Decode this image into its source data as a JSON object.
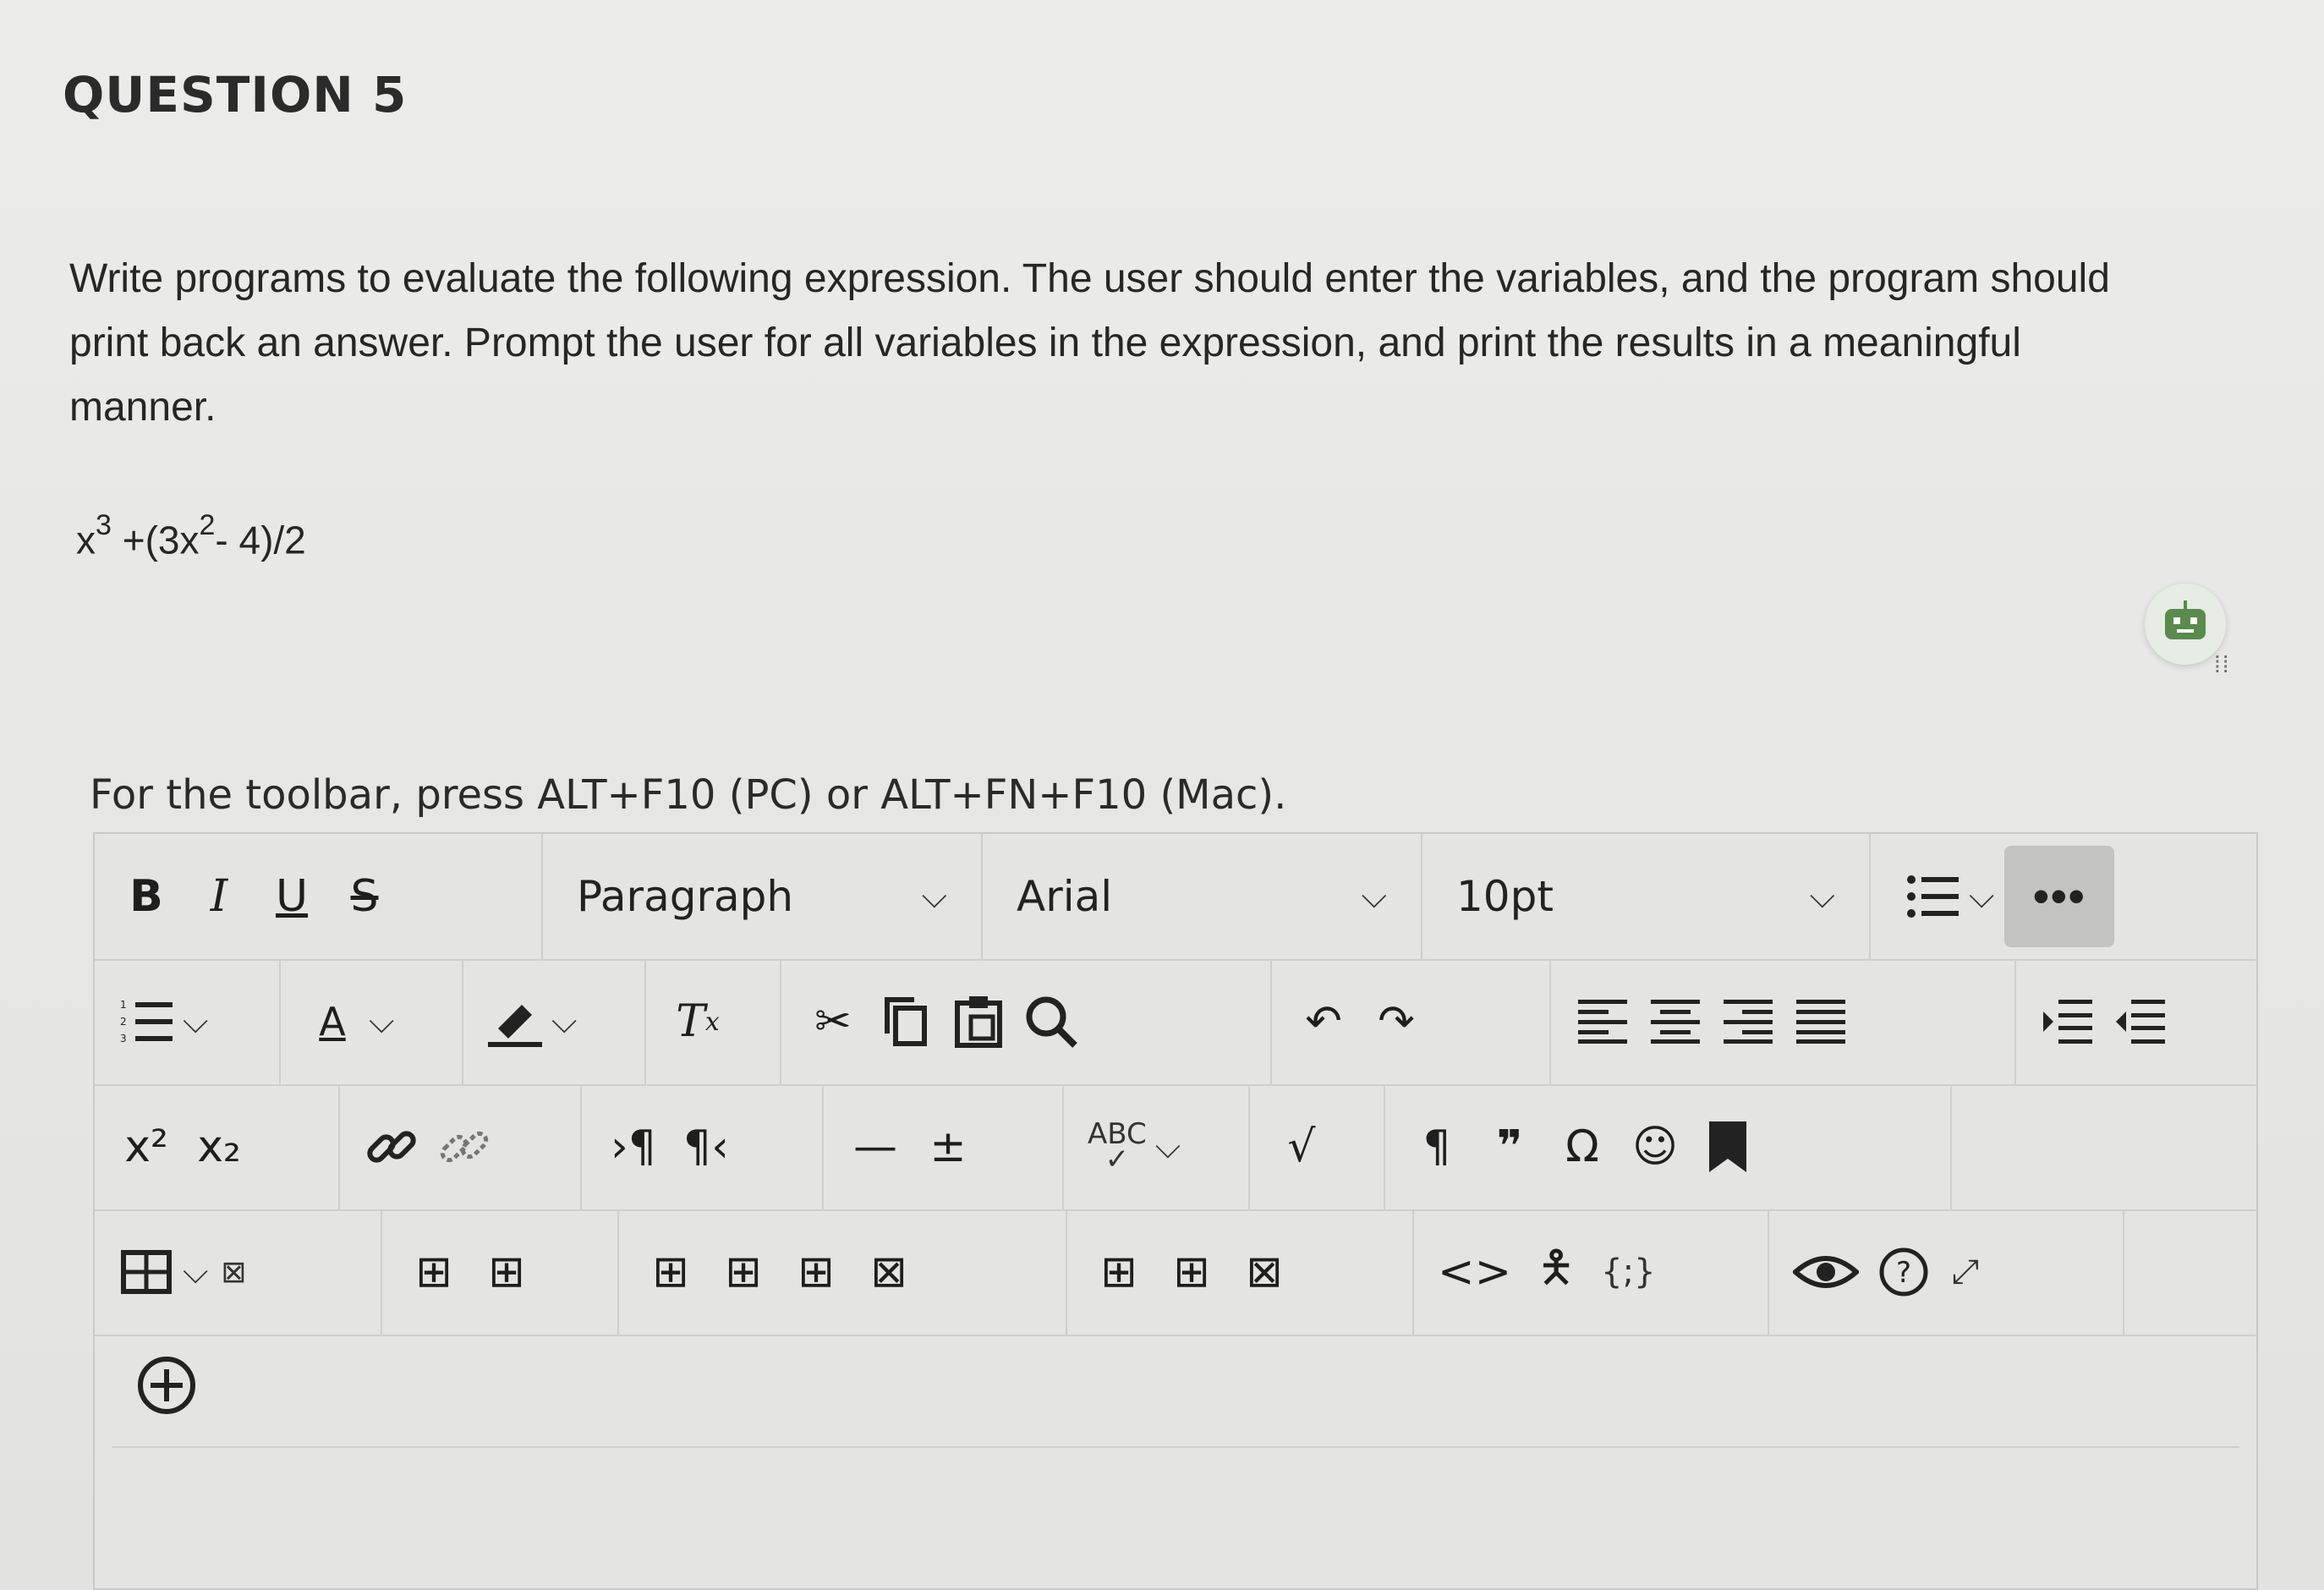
{
  "question": {
    "title": "QUESTION 5",
    "body": "Write programs to evaluate the following expression. The user should enter the variables, and the program should print back an answer. Prompt the user for all variables in the expression, and print the results in a meaningful manner.",
    "expression": {
      "part1": "x",
      "sup1": "3",
      "part2": " +(3x",
      "sup2": "2",
      "part3": "- 4)/2"
    }
  },
  "editor": {
    "hint": "For the toolbar, press ALT+F10 (PC) or ALT+FN+F10 (Mac).",
    "format": {
      "bold": "B",
      "italic": "I",
      "underline": "U",
      "strike": "S"
    },
    "paragraph_select": "Paragraph",
    "font_select": "Arial",
    "size_select": "10pt",
    "more_label": "•••",
    "font_color_label": "A",
    "superscript_label": "x²",
    "subscript_label": "x₂",
    "spellcheck_label": "ABC",
    "icons": {
      "numbered_list": "numbered-list-icon",
      "bullet_list": "bullet-list-icon",
      "font_color": "font-color-icon",
      "highlight": "highlight-icon",
      "clear_format": "clear-format-icon",
      "cut": "cut-icon",
      "copy": "copy-icon",
      "paste": "paste-icon",
      "find": "search-icon",
      "undo": "undo-icon",
      "redo": "redo-icon",
      "align_left": "align-left-icon",
      "align_center": "align-center-icon",
      "align_right": "align-right-icon",
      "justify": "justify-icon",
      "indent": "indent-icon",
      "outdent": "outdent-icon",
      "link": "link-icon",
      "unlink": "unlink-icon",
      "ltr": "ltr-icon",
      "rtl": "rtl-icon",
      "hr": "horizontal-rule-icon",
      "plus_minus": "plus-minus-icon",
      "math": "math-icon",
      "paragraph_mark": "pilcrow-icon",
      "quote": "quote-icon",
      "omega": "omega-icon",
      "emoji": "emoji-icon",
      "bookmark": "bookmark-icon",
      "table": "table-icon",
      "code": "code-icon",
      "accessibility": "accessibility-icon",
      "json": "json-icon",
      "preview": "eye-icon",
      "help": "help-icon",
      "fullscreen": "fullscreen-icon",
      "add": "add-content-icon"
    },
    "colors": {
      "toolbar_bg": "#e4e4e2",
      "border": "#cfcfcd",
      "more_bg": "#c3c3c1",
      "bot_green": "#5a8a4c"
    }
  }
}
